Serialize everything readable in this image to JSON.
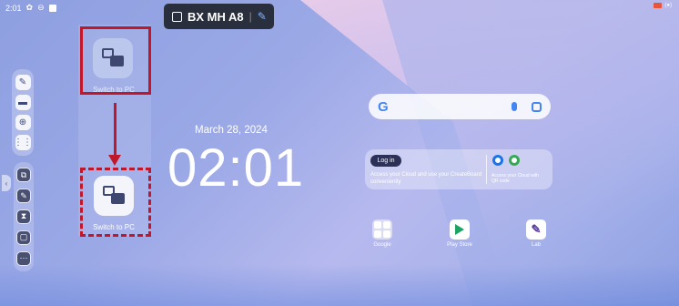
{
  "status_bar": {
    "time": "2:01",
    "battery_text": "(●)"
  },
  "topbar": {
    "device_id": "BX MH A8",
    "separator": "|"
  },
  "sidebar": {
    "top_icons": [
      "edit-note-icon",
      "window-icon",
      "globe-icon",
      "apps-grid-icon"
    ],
    "bottom_icons": [
      "screenshot-icon",
      "pen-icon",
      "timer-icon",
      "crop-icon",
      "more-icon"
    ]
  },
  "annotation": {
    "label_faded": "Switch to PC",
    "label_highlight": "Switch to PC"
  },
  "clock": {
    "date": "March 28, 2024",
    "time": "02:01"
  },
  "search": {
    "logo": "G"
  },
  "cloud": {
    "login_label": "Log in",
    "description": "Access your Cloud and use your CreateBoard conveniently",
    "qr_text": "Access your Cloud with QR code"
  },
  "apps": [
    {
      "label": "Google"
    },
    {
      "label": "Play Store"
    },
    {
      "label": "Lab"
    }
  ],
  "colors": {
    "highlight": "#c0182a",
    "toolbar": "#2a2f3d"
  }
}
